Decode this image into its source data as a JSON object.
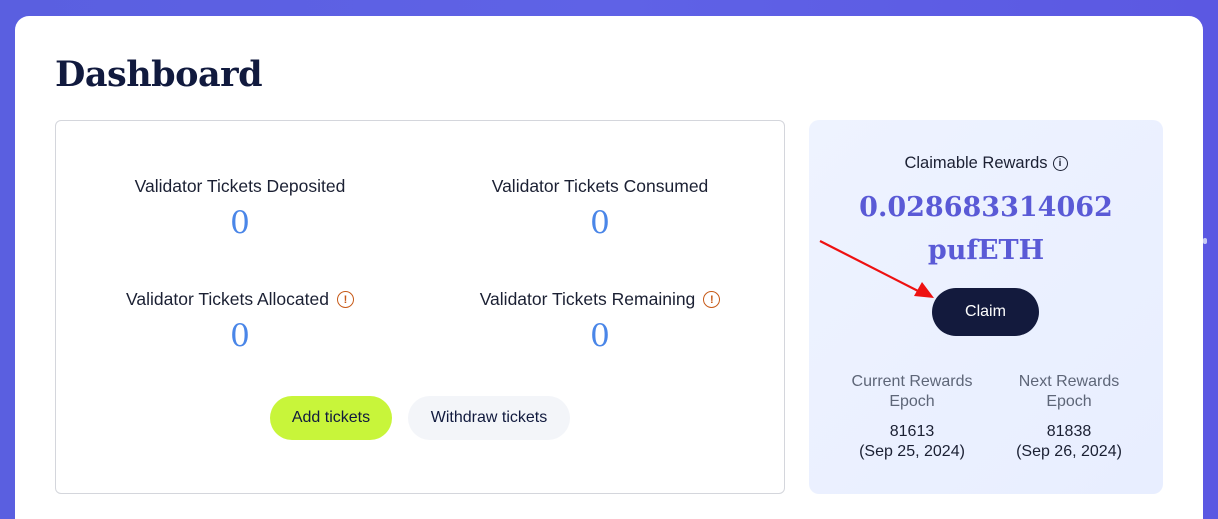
{
  "page": {
    "title": "Dashboard"
  },
  "stats": {
    "deposited": {
      "label": "Validator Tickets Deposited",
      "value": "0"
    },
    "consumed": {
      "label": "Validator Tickets Consumed",
      "value": "0"
    },
    "allocated": {
      "label": "Validator Tickets Allocated",
      "value": "0",
      "icon": "info-alert-icon"
    },
    "remaining": {
      "label": "Validator Tickets Remaining",
      "value": "0",
      "icon": "info-alert-icon"
    }
  },
  "actions": {
    "add_label": "Add tickets",
    "withdraw_label": "Withdraw tickets"
  },
  "rewards": {
    "label": "Claimable Rewards",
    "amount": "0.028683314062",
    "unit": "pufETH",
    "claim_label": "Claim",
    "current_epoch": {
      "label_line1": "Current Rewards",
      "label_line2": "Epoch",
      "value": "81613",
      "date": "(Sep 25, 2024)"
    },
    "next_epoch": {
      "label_line1": "Next Rewards",
      "label_line2": "Epoch",
      "value": "81838",
      "date": "(Sep 26, 2024)"
    }
  },
  "colors": {
    "background": "#5a5fe0",
    "accent_green": "#c8f53a",
    "navy": "#131a3d",
    "value_blue": "#4a86e8",
    "rewards_purple": "#5a5ad6",
    "annotation_arrow": "#ee1111"
  }
}
